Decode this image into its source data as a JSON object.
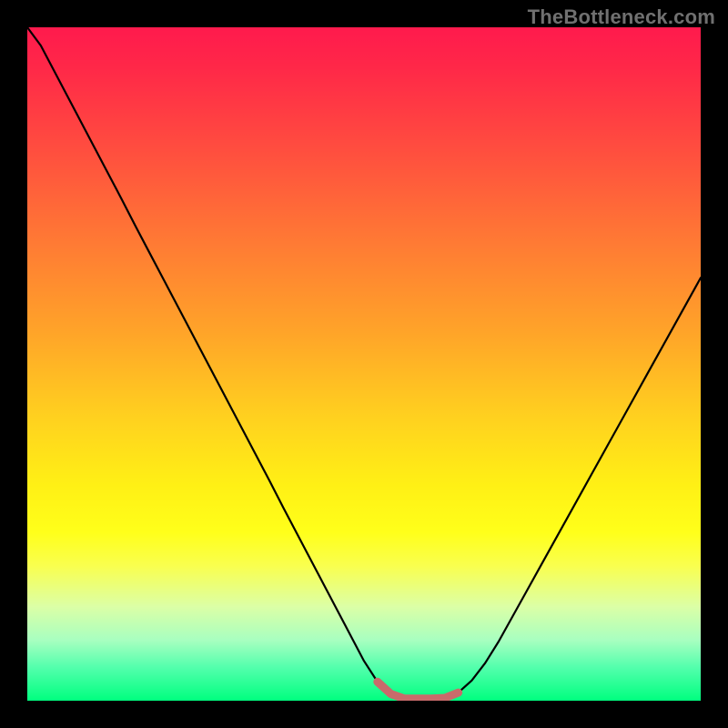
{
  "watermark": "TheBottleneck.com",
  "chart_data": {
    "type": "line",
    "title": "",
    "xlabel": "",
    "ylabel": "",
    "xlim": [
      0,
      100
    ],
    "ylim": [
      0,
      100
    ],
    "grid": false,
    "legend": false,
    "annotations": [],
    "axis_ticks": {
      "x": [],
      "y": []
    },
    "note": "Chart has no visible axis labels, tick labels, title, or legend. Values below are curve y-coordinates read off the plot area (0 = bottom/green, 100 = top/red) sampled at 51 evenly spaced x positions (0–100%). A short red overlay segment near the valley is recorded separately.",
    "series": [
      {
        "name": "black-curve",
        "color": "#000000",
        "x": [
          0,
          2,
          4,
          6,
          8,
          10,
          12,
          14,
          16,
          18,
          20,
          22,
          24,
          26,
          28,
          30,
          32,
          34,
          36,
          38,
          40,
          42,
          44,
          46,
          48,
          50,
          52,
          54,
          56,
          58,
          60,
          62,
          64,
          66,
          68,
          70,
          72,
          74,
          76,
          78,
          80,
          82,
          84,
          86,
          88,
          90,
          92,
          94,
          96,
          98,
          100
        ],
        "y": [
          100,
          97.3,
          93.5,
          89.7,
          85.9,
          82.1,
          78.3,
          74.5,
          70.6,
          66.8,
          63.0,
          59.2,
          55.4,
          51.6,
          47.8,
          44.0,
          40.2,
          36.4,
          32.6,
          28.7,
          24.9,
          21.1,
          17.3,
          13.5,
          9.7,
          5.9,
          2.8,
          1.0,
          0.3,
          0.3,
          0.3,
          0.4,
          1.2,
          3.0,
          5.6,
          8.8,
          12.4,
          16.0,
          19.6,
          23.2,
          26.8,
          30.4,
          34.0,
          37.6,
          41.2,
          44.8,
          48.4,
          52.0,
          55.6,
          59.2,
          62.8
        ]
      },
      {
        "name": "red-valley-overlay",
        "color": "#c96b6b",
        "x": [
          52,
          54,
          56,
          58,
          60,
          62,
          64
        ],
        "y": [
          2.8,
          1.0,
          0.3,
          0.3,
          0.3,
          0.4,
          1.2
        ]
      }
    ]
  }
}
